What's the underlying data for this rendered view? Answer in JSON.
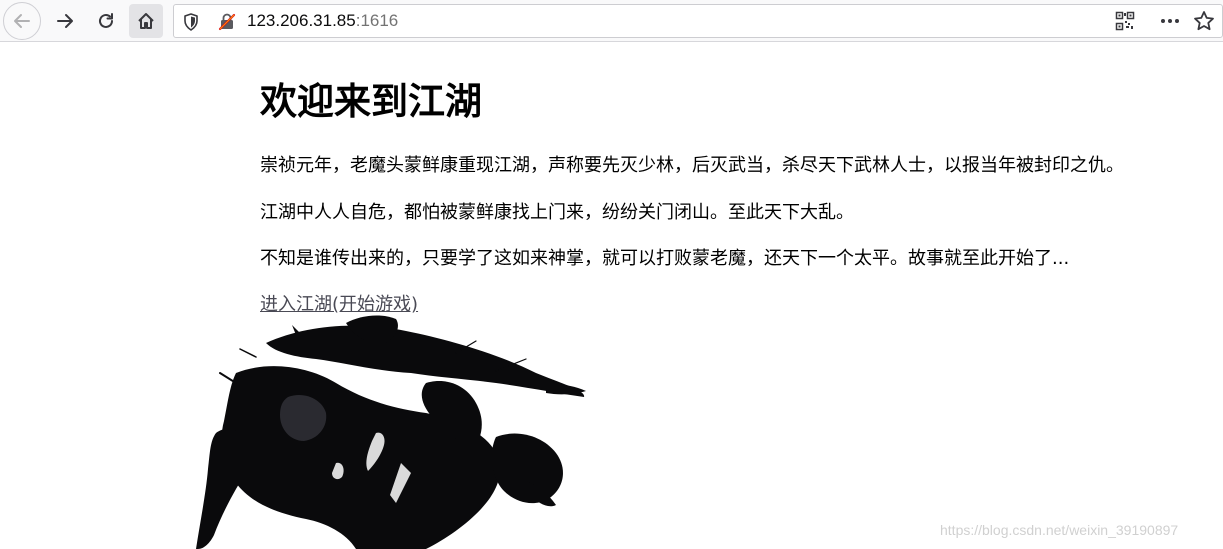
{
  "browser": {
    "url_host": "123.206.31.85",
    "url_port": ":1616"
  },
  "page": {
    "heading": "欢迎来到江湖",
    "paragraphs": [
      "崇祯元年，老魔头蒙鲜康重现江湖，声称要先灭少林，后灭武当，杀尽天下武林人士，以报当年被封印之仇。",
      "江湖中人人自危，都怕被蒙鲜康找上门来，纷纷关门闭山。至此天下大乱。",
      "不知是谁传出来的，只要学了这如来神掌，就可以打败蒙老魔，还天下一个太平。故事就至此开始了..."
    ],
    "start_link": "进入江湖(开始游戏)"
  },
  "watermark": "https://blog.csdn.net/weixin_39190897",
  "icons": [
    "back-icon",
    "forward-icon",
    "reload-icon",
    "home-icon",
    "shield-icon",
    "insecure-lock-icon",
    "qr-code-icon",
    "more-icon",
    "star-icon"
  ]
}
